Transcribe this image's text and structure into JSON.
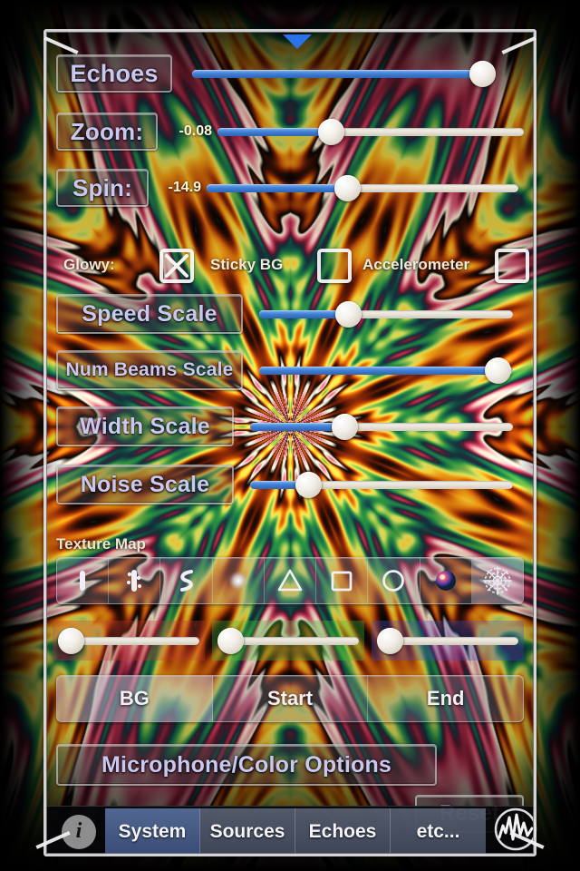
{
  "app": {
    "pull_handle": "pull-down-handle"
  },
  "controls": [
    {
      "label": "Echoes",
      "value": "",
      "percent": 97,
      "name": "echoes"
    },
    {
      "label": "Zoom:",
      "value": "-0.08",
      "percent": 37,
      "name": "zoom"
    },
    {
      "label": "Spin:",
      "value": "-14.9",
      "percent": 45,
      "name": "spin"
    }
  ],
  "toggles": [
    {
      "label": "Glowy:",
      "checked": true,
      "name": "glowy"
    },
    {
      "label": "Sticky BG",
      "checked": false,
      "name": "sticky-bg"
    },
    {
      "label": "Accelerometer",
      "checked": false,
      "name": "accelerometer"
    }
  ],
  "scales": [
    {
      "label": "Speed Scale",
      "percent": 35,
      "name": "speed-scale"
    },
    {
      "label": "Num Beams Scale",
      "percent": 94,
      "name": "num-beams-scale"
    },
    {
      "label": "Width Scale",
      "percent": 36,
      "name": "width-scale"
    },
    {
      "label": "Noise Scale",
      "percent": 22,
      "name": "noise-scale"
    }
  ],
  "texture_map": {
    "label": "Texture Map",
    "selected_index": 8,
    "items": [
      {
        "icon": "vertical-bar-icon",
        "name": "texture-bar"
      },
      {
        "icon": "textured-bar-icon",
        "name": "texture-speckle-bar"
      },
      {
        "icon": "s-curve-icon",
        "name": "texture-s-curve"
      },
      {
        "icon": "soft-dot-icon",
        "name": "texture-dot"
      },
      {
        "icon": "triangle-icon",
        "name": "texture-triangle"
      },
      {
        "icon": "square-icon",
        "name": "texture-square"
      },
      {
        "icon": "circle-icon",
        "name": "texture-circle"
      },
      {
        "icon": "color-sphere-icon",
        "name": "texture-color-sphere"
      },
      {
        "icon": "starburst-icon",
        "name": "texture-starburst"
      }
    ]
  },
  "color_sliders": [
    {
      "channel": "red",
      "percent": 9,
      "name": "color-slider-red"
    },
    {
      "channel": "green",
      "percent": 9,
      "name": "color-slider-green"
    },
    {
      "channel": "blue",
      "percent": 9,
      "name": "color-slider-blue"
    }
  ],
  "color_target": {
    "selected_index": 0,
    "items": [
      {
        "label": "BG",
        "name": "color-target-bg"
      },
      {
        "label": "Start",
        "name": "color-target-start"
      },
      {
        "label": "End",
        "name": "color-target-end"
      }
    ]
  },
  "buttons": {
    "microphone_color_options": "Microphone/Color Options",
    "reset": "Reset"
  },
  "bottom_bar": {
    "info_icon": "info-icon",
    "waveform_icon": "waveform-icon",
    "active_index": 0,
    "tabs": [
      {
        "label": "System",
        "name": "tab-system"
      },
      {
        "label": "Sources",
        "name": "tab-sources"
      },
      {
        "label": "Echoes",
        "name": "tab-echoes"
      },
      {
        "label": "etc...",
        "name": "tab-etc"
      }
    ]
  },
  "colors": {
    "slider_fill": "#3f7fd6",
    "label_text": "#c9c8f0",
    "value_text": "#fdf6d8",
    "handle": "#2a72e8"
  }
}
